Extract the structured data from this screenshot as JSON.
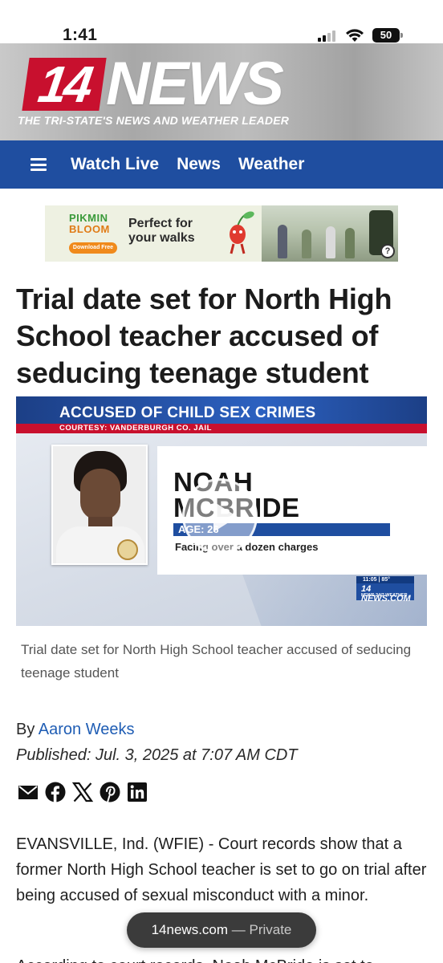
{
  "status_bar": {
    "time": "1:41",
    "battery": "50"
  },
  "header": {
    "logo_number": "14",
    "logo_word": "NEWS",
    "tagline": "THE TRI-STATE'S NEWS AND WEATHER LEADER",
    "brand_red": "#c8102e",
    "nav_blue": "#1f4ea0"
  },
  "nav": {
    "menu_icon": "hamburger-icon",
    "items": [
      "Watch Live",
      "News",
      "Weather"
    ]
  },
  "ad": {
    "brand_line1": "PIKMIN",
    "brand_line2": "BLOOM",
    "cta": "Download Free",
    "headline": "Perfect for your walks",
    "help_icon": "?"
  },
  "article": {
    "headline": "Trial date set for North High School teacher accused of seducing teenage student",
    "video": {
      "banner_title": "ACCUSED OF CHILD SEX CRIMES",
      "banner_sub": "COURTESY: VANDERBURGH CO. JAIL",
      "name_line1": "NOAH",
      "name_line2": "MCBRIDE",
      "age": "AGE: 26",
      "charges": "Facing over a dozen charges",
      "bug_top": "11:05 | 85°",
      "bug_main": "14 NEWS.COM",
      "bug_sub": "NEWS 24/7 WEATHER"
    },
    "caption": "Trial date set for North High School teacher accused of seducing teenage student",
    "byline_prefix": "By ",
    "author": "Aaron Weeks",
    "published": "Published: Jul. 3, 2025 at 7:07 AM CDT",
    "share_icons": [
      "email-icon",
      "facebook-icon",
      "x-icon",
      "pinterest-icon",
      "linkedin-icon"
    ],
    "paragraph1": "EVANSVILLE, Ind. (WFIE) - Court records show that a former North High School teacher is set to go on trial after being accused of sexual misconduct with a minor.",
    "paragraph2": "According to court records, Noah McBride is set to"
  },
  "browser": {
    "url": "14news.com",
    "mode": " — Private"
  }
}
